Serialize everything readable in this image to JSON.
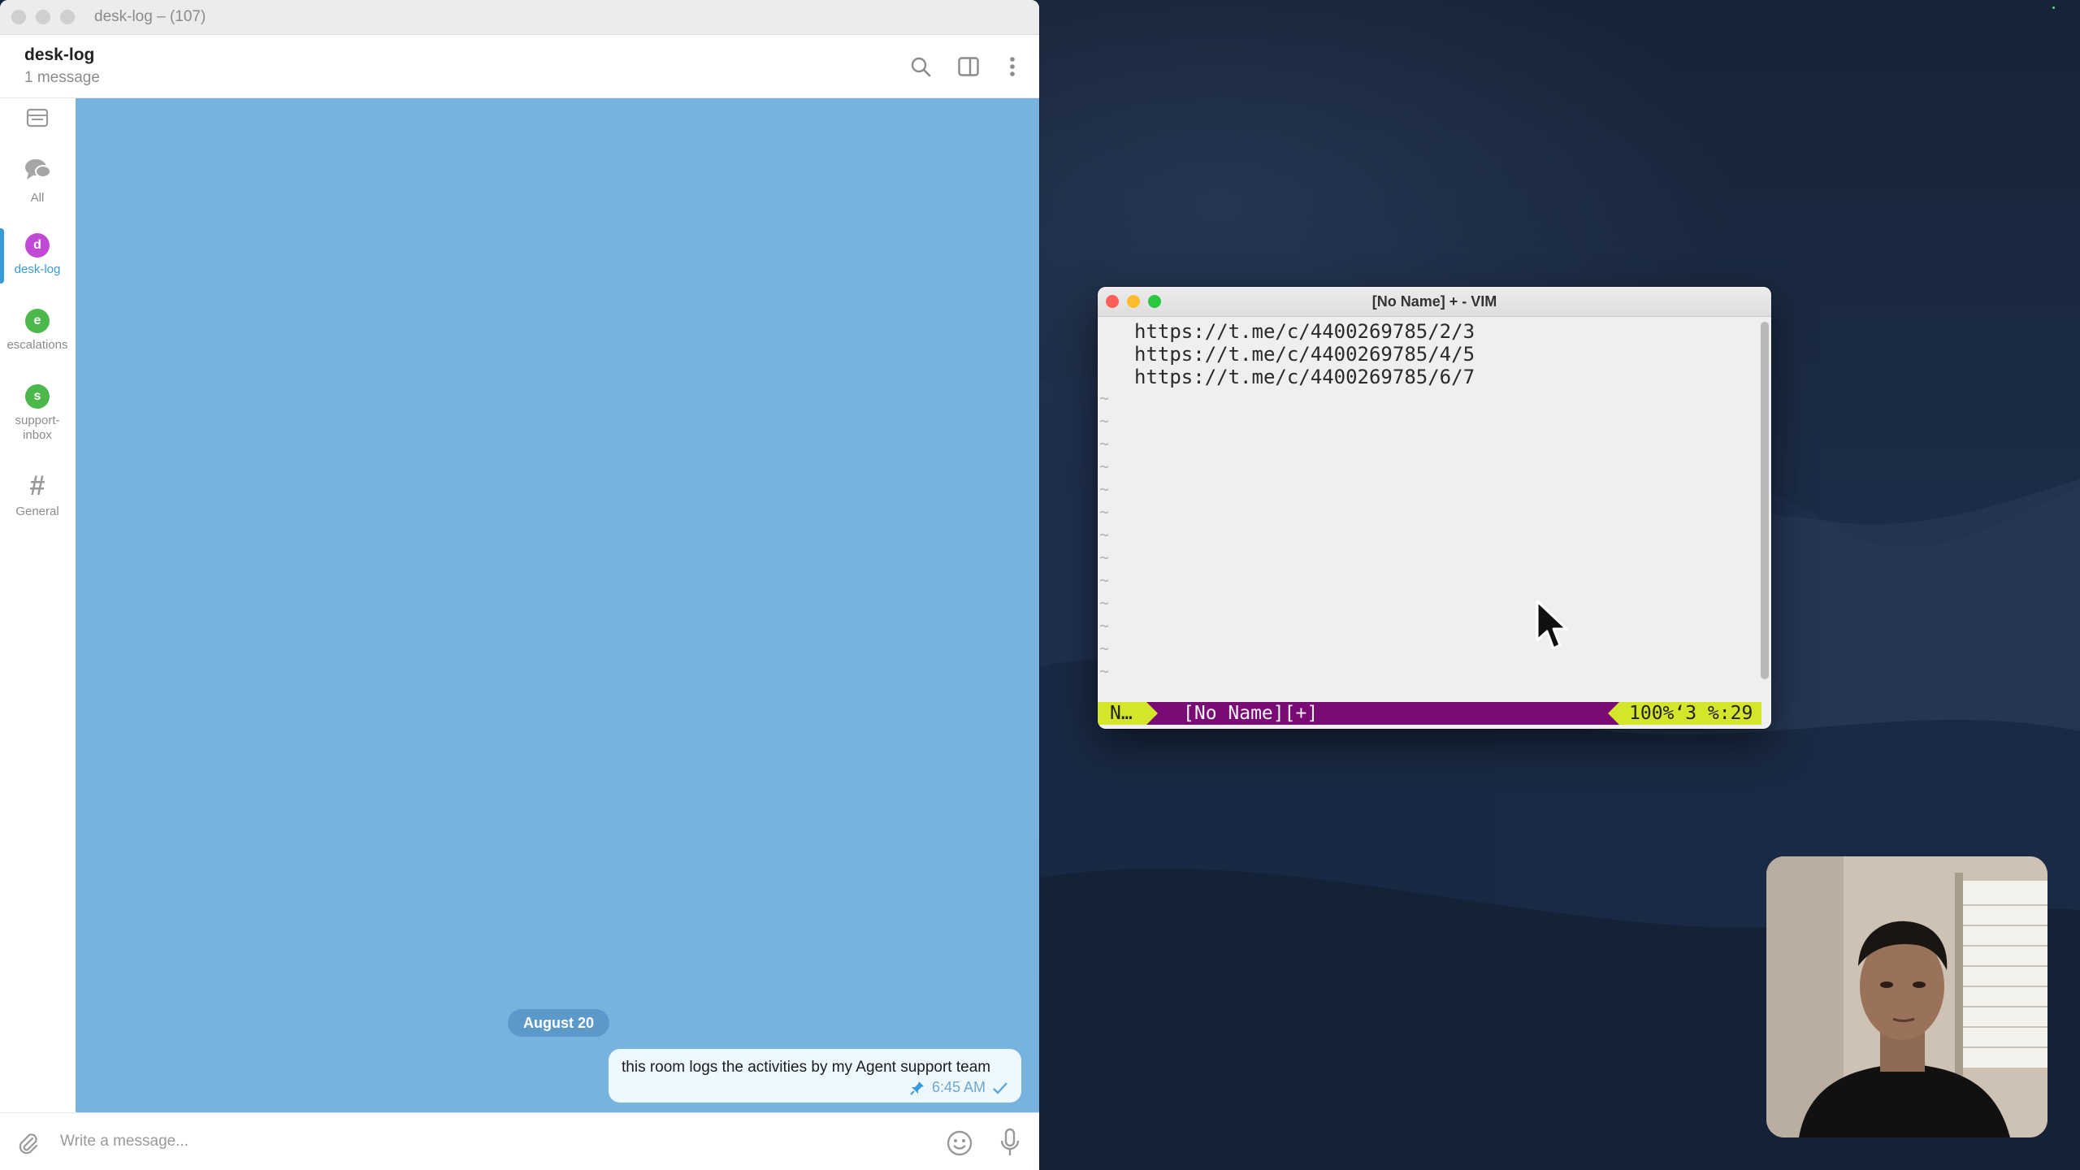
{
  "telegram": {
    "window_title": "desk-log – (107)",
    "chat_name": "desk-log",
    "chat_subtitle": "1 message",
    "folders": [
      {
        "label": "All"
      },
      {
        "label": "desk-log",
        "initial": "d",
        "color": "#c04ad6"
      },
      {
        "label": "escalations",
        "initial": "e",
        "color": "#4cb84c"
      },
      {
        "label": "support-",
        "label2": "inbox",
        "initial": "s",
        "color": "#4cb84c"
      },
      {
        "label": "General",
        "icon": "#"
      }
    ],
    "date_separator": "August 20",
    "message": {
      "text": "this room logs the activities by my Agent support team",
      "time": "6:45 AM"
    },
    "composer_placeholder": "Write a message..."
  },
  "vim": {
    "title": "[No Name] + - VIM",
    "lines": [
      "https://t.me/c/4400269785/2/3",
      "https://t.me/c/4400269785/4/5",
      "https://t.me/c/4400269785/6/7"
    ],
    "tilde": "~",
    "status_mode": "N…",
    "status_file": "[No Name][+]",
    "status_pos": "100%‘3 %:29"
  },
  "colors": {
    "accent": "#3a9bd8",
    "chat_bg": "#78b3df",
    "vim_status": "#7a0a76",
    "vim_mode": "#d4e52a"
  }
}
